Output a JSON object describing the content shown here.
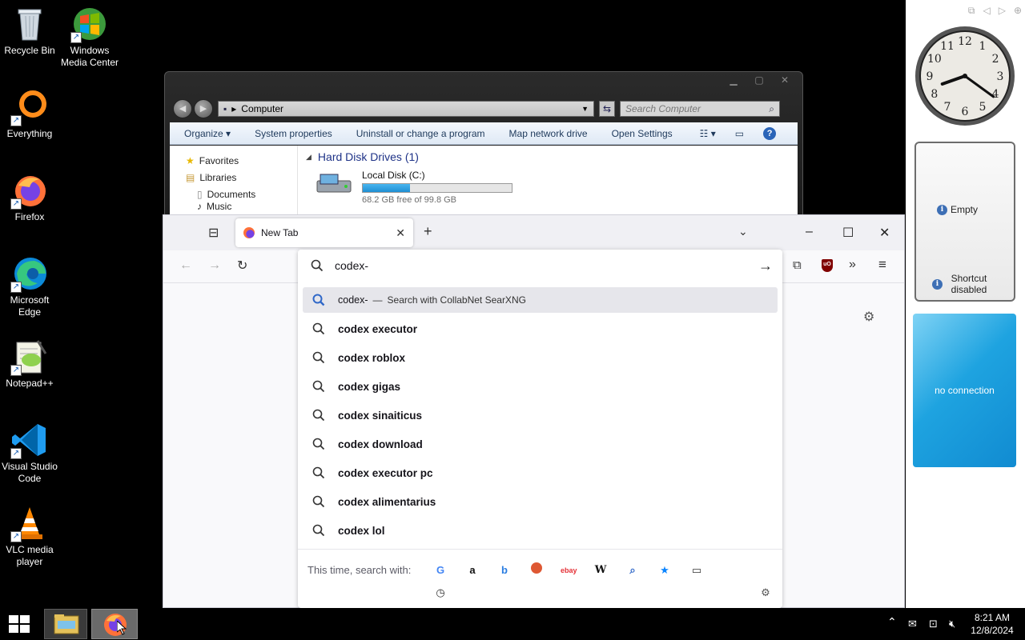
{
  "desktop": {
    "icons": [
      {
        "label": "Recycle Bin"
      },
      {
        "label": "Windows Media Center"
      },
      {
        "label": "Everything"
      },
      {
        "label": "Firefox"
      },
      {
        "label": "Microsoft Edge"
      },
      {
        "label": "Notepad++"
      },
      {
        "label": "Visual Studio Code"
      },
      {
        "label": "VLC media player"
      }
    ]
  },
  "explorer": {
    "address": "Computer",
    "search_placeholder": "Search Computer",
    "commands": [
      "Organize ▾",
      "System properties",
      "Uninstall or change a program",
      "Map network drive",
      "Open Settings"
    ],
    "nav": [
      "Favorites",
      "Libraries",
      "Documents",
      "Music"
    ],
    "group_header": "Hard Disk Drives (1)",
    "disk": {
      "name": "Local Disk (C:)",
      "free_text": "68.2 GB free of 99.8 GB",
      "used_fraction": 0.317
    }
  },
  "firefox": {
    "tab_title": "New Tab",
    "urlbar_value": "codex-",
    "first_suggestion": {
      "text": "codex-",
      "separator": "—",
      "desc": "Search with CollabNet SearXNG"
    },
    "suggestions": [
      "codex executor",
      "codex roblox",
      "codex gigas",
      "codex sinaiticus",
      "codex download",
      "codex executor pc",
      "codex alimentarius",
      "codex lol"
    ],
    "onebar_label": "This time, search with:",
    "engines": [
      "google-icon",
      "amazon-icon",
      "bing-icon",
      "duckduckgo-icon",
      "ebay-icon",
      "wikipedia-icon",
      "searxng-icon",
      "bookmarks-icon",
      "tabs-icon",
      "history-icon"
    ]
  },
  "gadgets": {
    "slideshow_empty": "Empty",
    "shortcut_msg": "Shortcut disabled",
    "weather_msg": "no connection",
    "clock_face": [
      "12",
      "1",
      "2",
      "3",
      "4",
      "5",
      "6",
      "7",
      "8",
      "9",
      "10",
      "11"
    ]
  },
  "taskbar": {
    "time": "8:21 AM",
    "date": "12/8/2024"
  },
  "colors": {
    "desktop_bg": "#000000",
    "accent": "#0061e0",
    "disk_fill": "#26a0da",
    "weather_blue": "#1ea3e0"
  }
}
